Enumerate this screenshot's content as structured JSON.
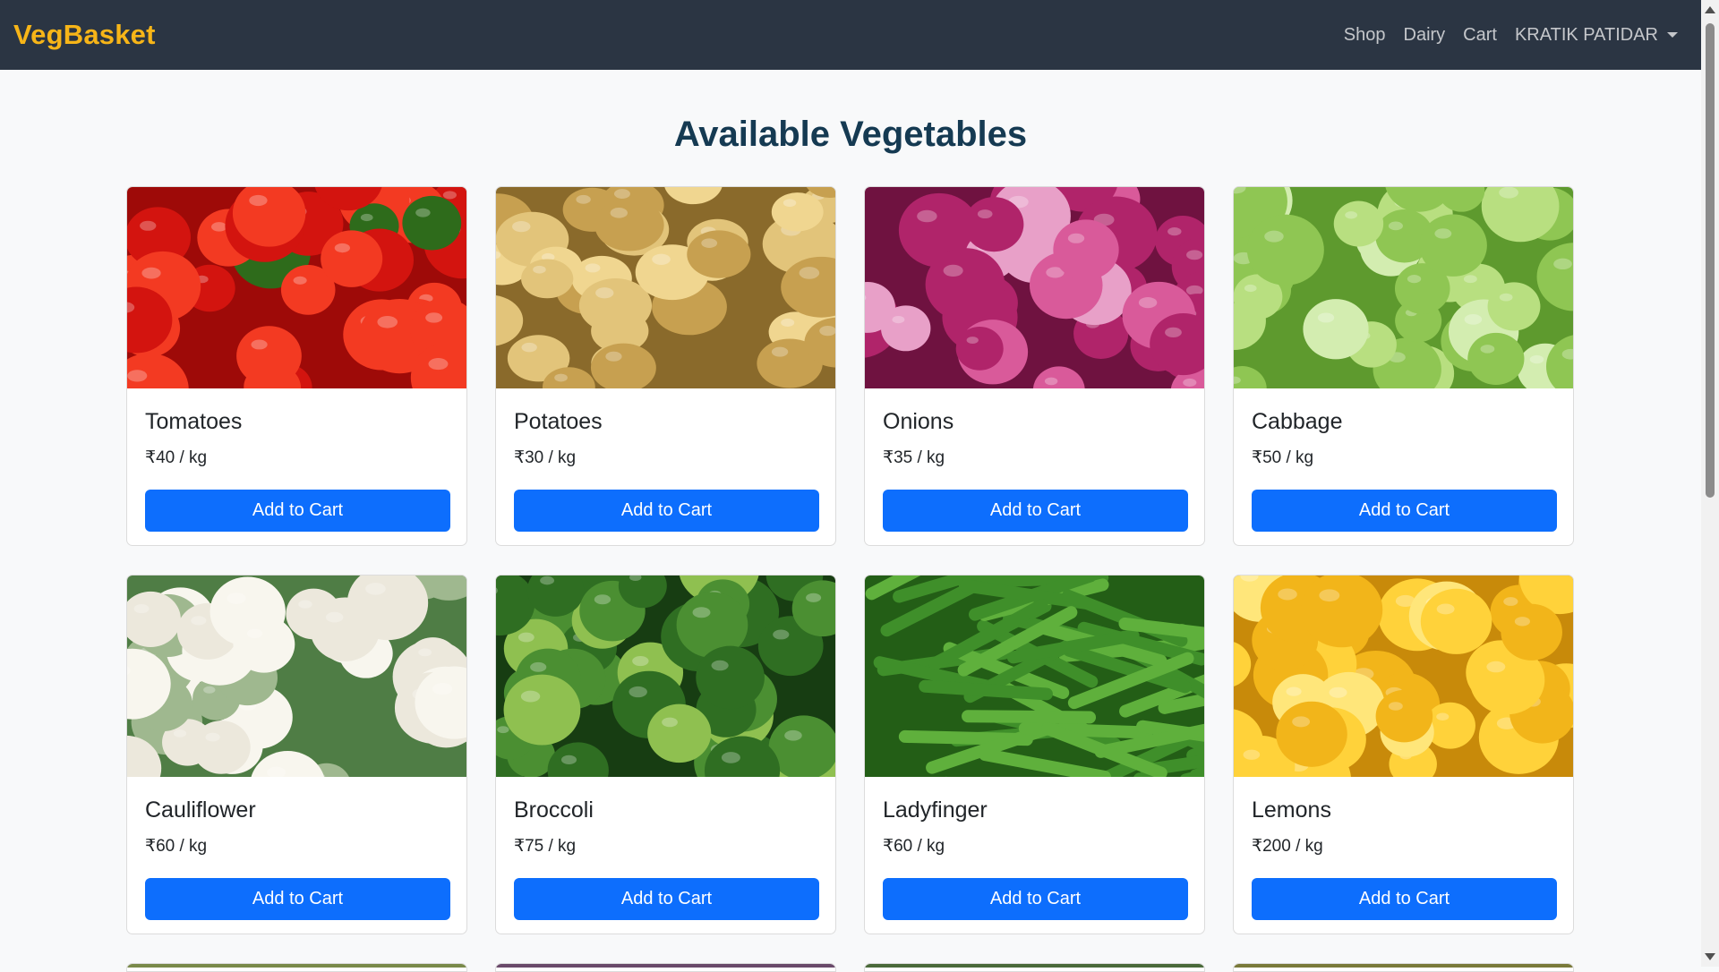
{
  "brand": {
    "name": "VegBasket",
    "color": "#f7b518"
  },
  "nav": {
    "shop": "Shop",
    "dairy": "Dairy",
    "cart": "Cart",
    "user": "KRATIK PATIDAR"
  },
  "page": {
    "title": "Available Vegetables"
  },
  "products": [
    {
      "name": "Tomatoes",
      "price": "₹40 / kg",
      "button": "Add to Cart",
      "image": "tomatoes",
      "colors": [
        "#d3140f",
        "#f33a22",
        "#9e0a08",
        "#2e6b1b"
      ]
    },
    {
      "name": "Potatoes",
      "price": "₹30 / kg",
      "button": "Add to Cart",
      "image": "potatoes",
      "colors": [
        "#c7a050",
        "#e2c47a",
        "#8a6a2b",
        "#f0d690"
      ]
    },
    {
      "name": "Onions",
      "price": "₹35 / kg",
      "button": "Add to Cart",
      "image": "onions",
      "colors": [
        "#b0246a",
        "#d95a9a",
        "#6f1240",
        "#e8a0c8"
      ]
    },
    {
      "name": "Cabbage",
      "price": "₹50 / kg",
      "button": "Add to Cart",
      "image": "cabbage",
      "colors": [
        "#8fc653",
        "#b8df80",
        "#5e9a2e",
        "#d3edb0"
      ]
    },
    {
      "name": "Cauliflower",
      "price": "₹60 / kg",
      "button": "Add to Cart",
      "image": "cauliflower",
      "colors": [
        "#ece8dc",
        "#f8f6ee",
        "#4f7d45",
        "#9fb88f"
      ]
    },
    {
      "name": "Broccoli",
      "price": "₹75 / kg",
      "button": "Add to Cart",
      "image": "broccoli",
      "colors": [
        "#2f6e22",
        "#4b8f32",
        "#173d12",
        "#8fc050"
      ]
    },
    {
      "name": "Ladyfinger",
      "price": "₹60 / kg",
      "button": "Add to Cart",
      "image": "ladyfinger",
      "colors": [
        "#3f8f2a",
        "#5fb03c",
        "#235e16",
        "#8ecb5c"
      ]
    },
    {
      "name": "Lemons",
      "price": "₹200 / kg",
      "button": "Add to Cart",
      "image": "lemons",
      "colors": [
        "#f2b51a",
        "#ffd23a",
        "#c88a0a",
        "#ffe67a"
      ]
    }
  ],
  "theme": {
    "button_color": "#0d6efd",
    "navbar_color": "#2b3543"
  }
}
